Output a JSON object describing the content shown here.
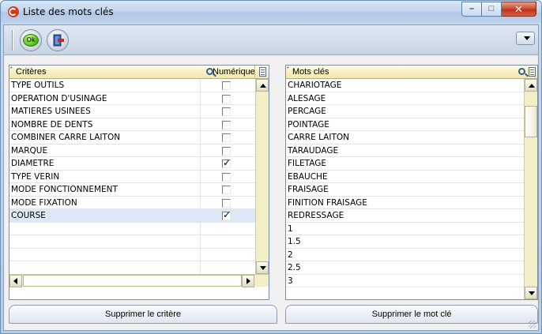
{
  "window": {
    "title": "Liste des mots clés",
    "buttons": {
      "minimize": "–",
      "maximize": "□",
      "close": "✕"
    }
  },
  "toolbar": {
    "ok_label": "Ok",
    "exit_icon": "exit-door-icon"
  },
  "criteria_table": {
    "col_criteria": "Critères",
    "col_numeric": "Numérique",
    "rows": [
      {
        "label": "TYPE OUTILS",
        "numeric": false
      },
      {
        "label": "OPERATION D'USINAGE",
        "numeric": false
      },
      {
        "label": "MATIERES USINEES",
        "numeric": false
      },
      {
        "label": "NOMBRE DE DENTS",
        "numeric": false
      },
      {
        "label": "COMBINER CARRE LAITON",
        "numeric": false
      },
      {
        "label": "MARQUE",
        "numeric": false
      },
      {
        "label": "DIAMETRE",
        "numeric": true
      },
      {
        "label": "TYPE VERIN",
        "numeric": false
      },
      {
        "label": "MODE FONCTIONNEMENT",
        "numeric": false
      },
      {
        "label": "MODE FIXATION",
        "numeric": false
      },
      {
        "label": "COURSE",
        "numeric": true
      }
    ],
    "selected_index": 10
  },
  "keywords_table": {
    "col_keywords": "Mots clés",
    "rows": [
      "CHARIOTAGE",
      "ALESAGE",
      "PERCAGE",
      "POINTAGE",
      "CARRE LAITON",
      "TARAUDAGE",
      "FILETAGE",
      "EBAUCHE",
      "FRAISAGE",
      "FINITION FRAISAGE",
      "REDRESSAGE",
      "1",
      "1.5",
      "2",
      "2.5",
      "3"
    ]
  },
  "actions": {
    "delete_criterion": "Supprimer le critère",
    "delete_keyword": "Supprimer le mot clé"
  },
  "colors": {
    "header_bg": "#f3e7a8",
    "selection": "#dce8f5",
    "title_gradient": "#c3d6ee"
  }
}
